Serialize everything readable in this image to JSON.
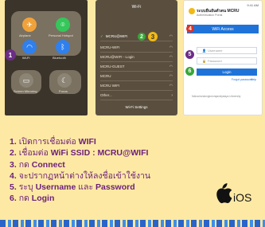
{
  "panel1": {
    "labels": [
      "Airplane",
      "Personal Hotspot",
      "Wi-Fi",
      "Bluetooth",
      "Screen Mirroring",
      "Focus"
    ],
    "step_badge": "1"
  },
  "panel2": {
    "title": "Wi-Fi",
    "selected_network": "MCRU@WIFI",
    "networks": [
      "MCRU-WIFI",
      "MCRU@WIFI - Login",
      "MCRU-GUEST",
      "MCRU",
      "MCRU WIFI",
      "Other..."
    ],
    "settings_label": "Wi-Fi Settings",
    "badge2": "2",
    "badge3": "3"
  },
  "panel3": {
    "status": "9:41 AM",
    "header_title": "ระบบยืนยันตัวตน MCRU",
    "header_sub": "Authentication Portal",
    "banner": "WiFi Access",
    "username_placeholder": "Username",
    "password_placeholder": "Password",
    "login_label": "Login",
    "link1": "Forgot password",
    "link2": "Help",
    "footer": "Mahachulalongkornrajavidyalaya University",
    "badge4": "4",
    "badge5": "5",
    "badge6": "6"
  },
  "instructions": [
    {
      "num": "1.",
      "text": "เปิดการเชื่อมต่อ",
      "kw": "WIFI"
    },
    {
      "num": "2.",
      "text": "เชื่อมต่อ",
      "kw": "WiFi SSID : MCRU@WIFI"
    },
    {
      "num": "3.",
      "text": "กด",
      "kw": "Connect"
    },
    {
      "num": "4.",
      "text": "จะปรากฏหน้าต่างให้ลงชื่อเข้าใช้งาน",
      "kw": ""
    },
    {
      "num": "5.",
      "text": "ระบุ",
      "kw": "Username",
      "text2": "และ",
      "kw2": "Password"
    },
    {
      "num": "6.",
      "text": "กด",
      "kw": "Login"
    }
  ],
  "brand": {
    "apple_icon": "apple-logo-icon",
    "ios_text": "iOS"
  },
  "colors": {
    "background": "#fde9a4",
    "instruction_text": "#6b1f7a",
    "step_purple": "#6b2d86",
    "step_green": "#3aa63a",
    "step_yellow": "#f2b916",
    "portal_blue": "#1f73d8",
    "portal_red": "#d9342b"
  }
}
